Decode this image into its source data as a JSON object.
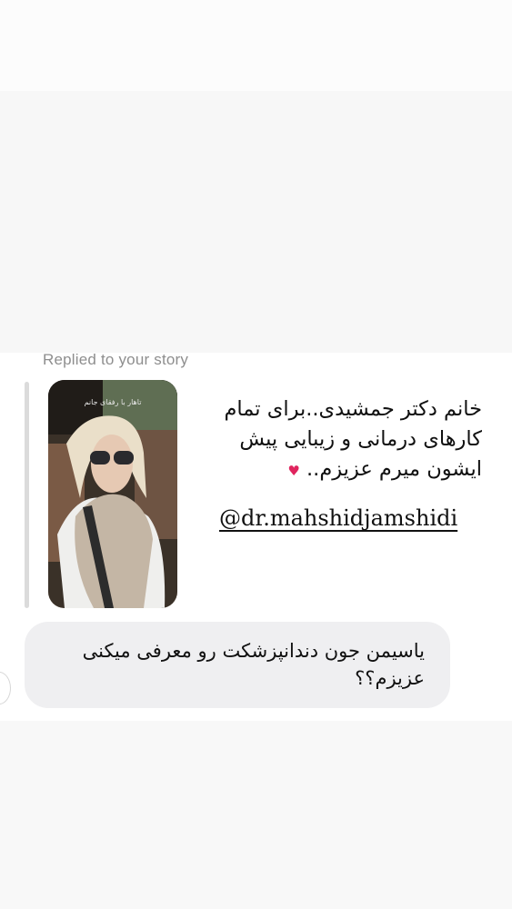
{
  "reply": {
    "context_label": "Replied to your story",
    "story": {
      "image_caption": "تاهار با رفقای جانم",
      "text_lines": [
        "خانم دکتر جمشیدی..برای تمام",
        "کارهای درمانی و زیبایی پیش",
        "ایشون میرم عزیزم.."
      ],
      "heart": "♥",
      "mention": "@dr.mahshidjamshidi"
    },
    "message": "یاسیمن جون دندانپزشکت رو معرفی میکنی عزیزم؟؟"
  },
  "colors": {
    "bubble": "#efeff1",
    "muted_text": "#8e8e8e",
    "heart": "#e0245e",
    "quote_bar": "#dbdbdb"
  }
}
